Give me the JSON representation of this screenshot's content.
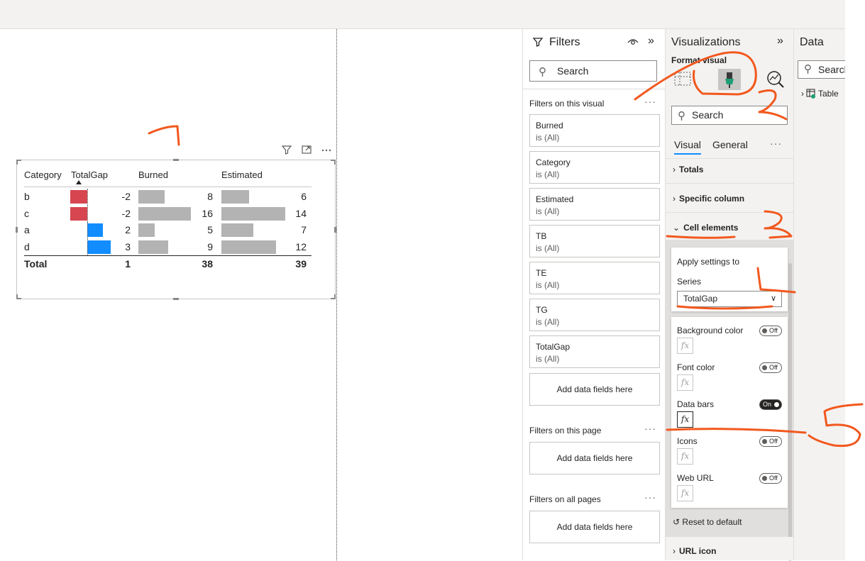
{
  "table": {
    "headers": [
      "Category",
      "TotalGap",
      "Burned",
      "Estimated"
    ],
    "rows": [
      {
        "category": "b",
        "totalgap": "-2",
        "burned": "8",
        "estimated": "6"
      },
      {
        "category": "c",
        "totalgap": "-2",
        "burned": "16",
        "estimated": "14"
      },
      {
        "category": "a",
        "totalgap": "2",
        "burned": "5",
        "estimated": "7"
      },
      {
        "category": "d",
        "totalgap": "3",
        "burned": "9",
        "estimated": "12"
      }
    ],
    "total": {
      "label": "Total",
      "totalgap": "1",
      "burned": "38",
      "estimated": "39"
    },
    "colors": {
      "negative": "#d64550",
      "positive": "#118dff",
      "neutral": "#b3b3b3"
    }
  },
  "visual_header": {
    "icons": [
      "filter-icon",
      "focus-mode-icon",
      "more-options-icon"
    ]
  },
  "annotations": {
    "mark_1": "1",
    "mark_2": "2",
    "mark_3": "3",
    "mark_4": "4",
    "mark_5": "5",
    "color": "#f2581d"
  },
  "filters": {
    "title": "Filters",
    "search_placeholder": "Search",
    "on_visual_label": "Filters on this visual",
    "cards": [
      {
        "field": "Burned",
        "state": "is (All)"
      },
      {
        "field": "Category",
        "state": "is (All)"
      },
      {
        "field": "Estimated",
        "state": "is (All)"
      },
      {
        "field": "TB",
        "state": "is (All)"
      },
      {
        "field": "TE",
        "state": "is (All)"
      },
      {
        "field": "TG",
        "state": "is (All)"
      },
      {
        "field": "TotalGap",
        "state": "is (All)"
      }
    ],
    "add_fields": "Add data fields here",
    "on_page_label": "Filters on this page",
    "all_pages_label": "Filters on all pages"
  },
  "visualizations": {
    "title": "Visualizations",
    "format_visual": "Format visual",
    "search_placeholder": "Search",
    "tabs": [
      "Visual",
      "General"
    ],
    "sections": {
      "totals": "Totals",
      "specific_column": "Specific column",
      "cell_elements": "Cell elements",
      "url_icon": "URL icon"
    },
    "apply_settings_to": "Apply settings to",
    "series_label": "Series",
    "series_value": "TotalGap",
    "settings": [
      {
        "label": "Background color",
        "toggle": "Off"
      },
      {
        "label": "Font color",
        "toggle": "Off"
      },
      {
        "label": "Data bars",
        "toggle": "On"
      },
      {
        "label": "Icons",
        "toggle": "Off"
      },
      {
        "label": "Web URL",
        "toggle": "Off"
      }
    ],
    "fx": "fx",
    "reset": "Reset to default"
  },
  "data_pane": {
    "title": "Data",
    "search_placeholder": "Search",
    "table_item": "Table"
  }
}
